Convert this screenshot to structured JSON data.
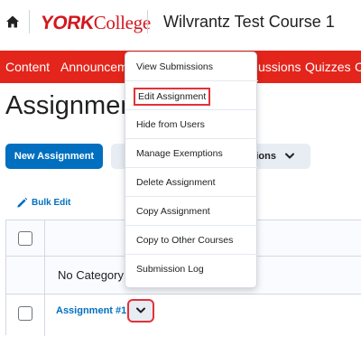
{
  "header": {
    "logo_york": "YORK",
    "logo_college": "College",
    "course_title": "Wilvrantz Test Course 1"
  },
  "nav": {
    "items": [
      "Content",
      "Announceme",
      "ussions",
      "Quizzes",
      "C"
    ]
  },
  "page": {
    "title": "Assignment",
    "new_assignment_label": "New Assignment",
    "more_actions_label": "ctions",
    "bulk_edit_label": "Bulk Edit"
  },
  "table": {
    "category_label": "No Category",
    "assignment_label": "Assignment #1"
  },
  "menu": {
    "items": [
      "View Submissions",
      "Edit Assignment",
      "Hide from Users",
      "Manage Exemptions",
      "Delete Assignment",
      "Copy Assignment",
      "Copy to Other Courses",
      "Submission Log"
    ],
    "highlighted_item": "Edit Assignment"
  },
  "colors": {
    "brand_red": "#e3251b",
    "link_blue": "#006fbf",
    "highlight_outline": "#e2323a"
  },
  "icons": {
    "home": "home-icon",
    "chevron": "chevron-down-icon",
    "bulk_edit": "pencil-icon"
  }
}
